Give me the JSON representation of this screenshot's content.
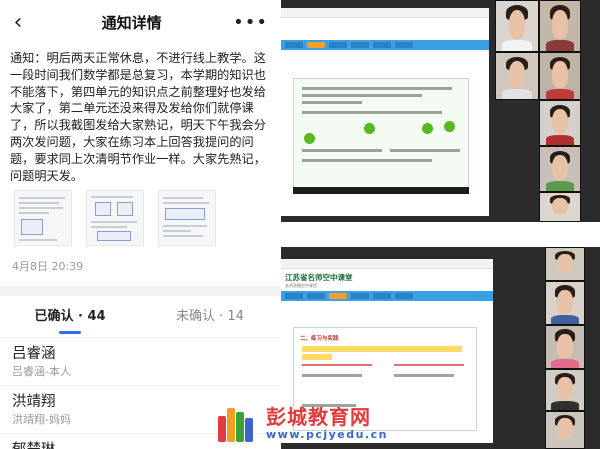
{
  "header": {
    "title": "通知详情",
    "back_icon": "chevron-left-icon",
    "more_icon": "more-dots-icon"
  },
  "notice": {
    "text": "通知：明后两天正常休息，不进行线上教学。这一段时间我们数学都是总复习，本学期的知识也不能落下，第四单元的知识点之前整理好也发给大家了，第二单元还没来得及发给你们就停课了，所以我截图发给大家熟记，明天下午我会分两次发问题，大家在练习本上回答我提问的问题，要求同上次清明节作业一样。大家先熟记，问题明天发。",
    "date": "4月8日 20:39"
  },
  "tabs": [
    {
      "label": "已确认 · 44",
      "active": true
    },
    {
      "label": "未确认 · 14",
      "active": false
    }
  ],
  "people": [
    {
      "name": "吕睿涵",
      "relation": "吕睿涵-本人"
    },
    {
      "name": "洪靖翔",
      "relation": "洪靖翔-妈妈"
    },
    {
      "name": "郁楚琳",
      "relation": ""
    }
  ],
  "screenshot2": {
    "brand": "江苏省名师空中课堂",
    "brand_sub": "名师直播空中课堂",
    "section": "二、练习与实践"
  },
  "watermark": {
    "name": "彭城教育网",
    "url": "www.pcjyedu.cn"
  },
  "colors": {
    "accent": "#2f6bff",
    "nav": "#3aa0e6",
    "watermark_red": "#e23b3b",
    "watermark_blue": "#3a66c8"
  }
}
